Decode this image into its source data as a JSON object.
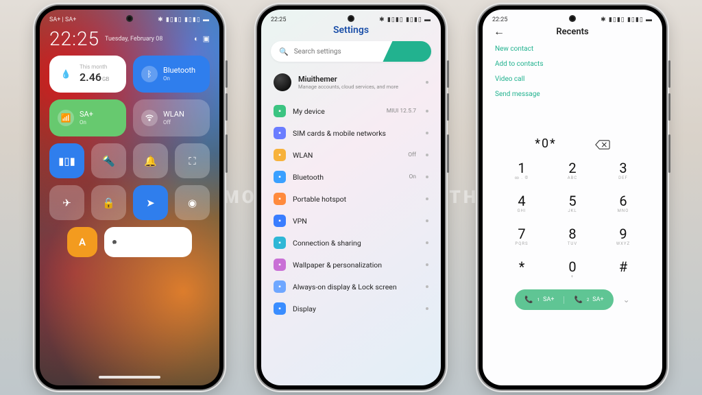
{
  "shared": {
    "time": "22:25",
    "status_icons": "✱ ▮▯▮▯ ▮▯▮▯ ▬"
  },
  "watermark": "VISIT FOR MORE THEMES · MIUITHEMER.COM",
  "phone1": {
    "carrier": "SA+ | SA+",
    "clock": "22:25",
    "date": "Tuesday, February 08",
    "tiles": {
      "data_label": "This month",
      "data_value": "2.46",
      "data_unit": "GB",
      "bt_label": "Bluetooth",
      "bt_state": "On",
      "sa_label": "SA+",
      "sa_state": "On",
      "wlan_label": "WLAN",
      "wlan_state": "Off"
    },
    "auto_letter": "A"
  },
  "phone2": {
    "title": "Settings",
    "search_placeholder": "Search settings",
    "account": {
      "name": "Miuithemer",
      "sub": "Manage accounts, cloud services, and more"
    },
    "rows": [
      {
        "icon_bg": "#3bc481",
        "label": "My device",
        "value": "MIUI 12.5.7"
      },
      {
        "icon_bg": "#6a7dff",
        "label": "SIM cards & mobile networks",
        "value": ""
      },
      {
        "icon_bg": "#f7b23b",
        "label": "WLAN",
        "value": "Off"
      },
      {
        "icon_bg": "#3aa0ff",
        "label": "Bluetooth",
        "value": "On"
      },
      {
        "icon_bg": "#ff8a3d",
        "label": "Portable hotspot",
        "value": ""
      },
      {
        "icon_bg": "#3a7dff",
        "label": "VPN",
        "value": ""
      },
      {
        "icon_bg": "#2fb7d6",
        "label": "Connection & sharing",
        "value": ""
      },
      {
        "icon_bg": "#c96fd6",
        "label": "Wallpaper & personalization",
        "value": ""
      },
      {
        "icon_bg": "#6fa7ff",
        "label": "Always-on display & Lock screen",
        "value": ""
      },
      {
        "icon_bg": "#3a8dff",
        "label": "Display",
        "value": ""
      }
    ]
  },
  "phone3": {
    "title": "Recents",
    "actions": [
      "New contact",
      "Add to contacts",
      "Video call",
      "Send message"
    ],
    "entered": "*0*",
    "keys": [
      {
        "n": "1",
        "l": "∞ . ©"
      },
      {
        "n": "2",
        "l": "ABC"
      },
      {
        "n": "3",
        "l": "DEF"
      },
      {
        "n": "4",
        "l": "GHI"
      },
      {
        "n": "5",
        "l": "JKL"
      },
      {
        "n": "6",
        "l": "MNO"
      },
      {
        "n": "7",
        "l": "PQRS"
      },
      {
        "n": "8",
        "l": "TUV"
      },
      {
        "n": "9",
        "l": "WXYZ"
      },
      {
        "n": "*",
        "l": ""
      },
      {
        "n": "0",
        "l": "+"
      },
      {
        "n": "#",
        "l": ""
      }
    ],
    "sim1_label": "SA+",
    "sim2_label": "SA+"
  }
}
